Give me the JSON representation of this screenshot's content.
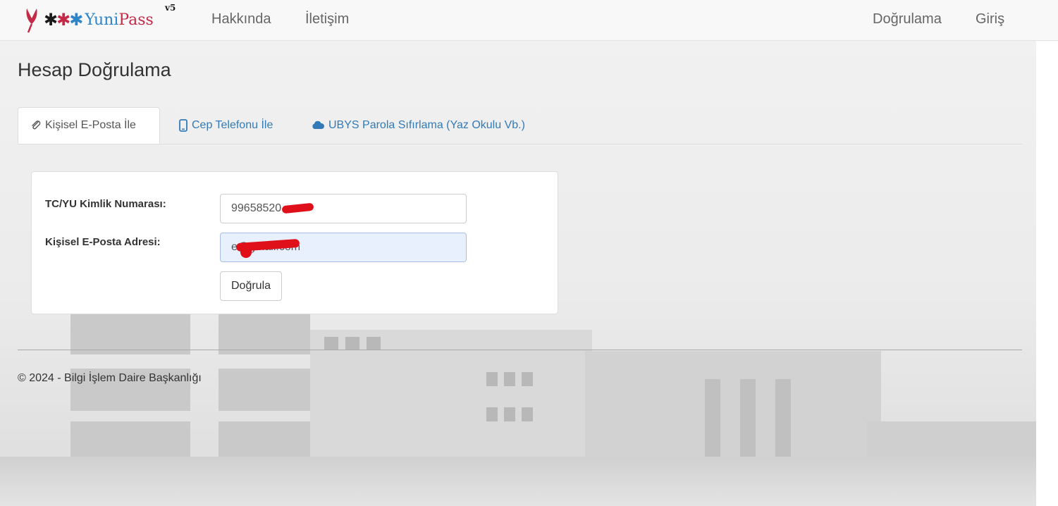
{
  "navbar": {
    "brand_word_yuni": "Yuni",
    "brand_word_pass": "Pass",
    "brand_version": "v5",
    "links_left": [
      "Hakkında",
      "İletişim"
    ],
    "links_right": [
      "Doğrulama",
      "Giriş"
    ]
  },
  "page": {
    "title": "Hesap Doğrulama"
  },
  "tabs": [
    {
      "label": "Kişisel E-Posta İle",
      "icon": "paperclip-icon",
      "active": true
    },
    {
      "label": "Cep Telefonu İle",
      "icon": "mobile-phone-icon",
      "active": false
    },
    {
      "label": "UBYS Parola Sıfırlama (Yaz Okulu Vb.)",
      "icon": "cloud-icon",
      "active": false
    }
  ],
  "form": {
    "id_label": "TC/YU Kimlik Numarası:",
    "id_value": "99658520",
    "email_label": "Kişisel E-Posta Adresi:",
    "email_value": "e@gmail.com",
    "submit_label": "Doğrula"
  },
  "footer": {
    "text": "© 2024 - Bilgi İşlem Daire Başkanlığı"
  },
  "colors": {
    "accent_blue": "#2e84c8",
    "brand_red": "#c42a47",
    "link_blue": "#337ab7",
    "redaction_red": "#e0101a"
  }
}
